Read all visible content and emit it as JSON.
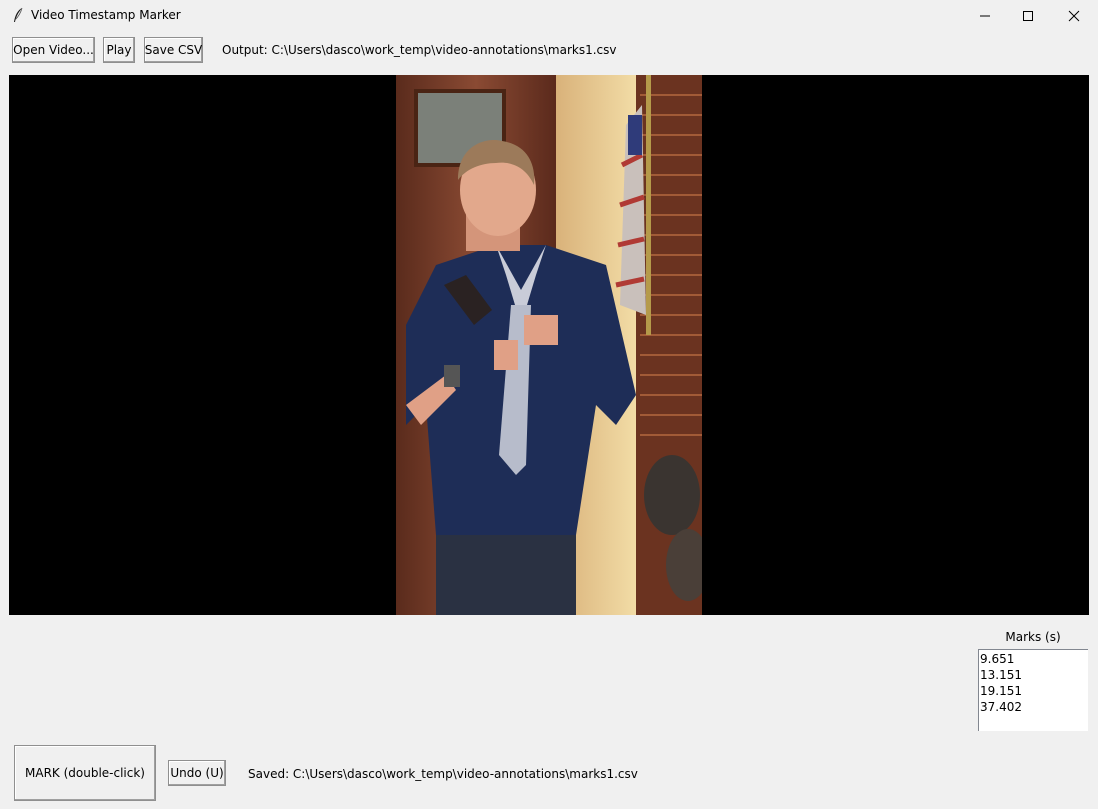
{
  "window": {
    "title": "Video Timestamp Marker",
    "icon": "feather-icon",
    "controls": [
      "minimize-icon",
      "maximize-icon",
      "close-icon"
    ]
  },
  "toolbar": {
    "open_label": "Open Video...",
    "play_label": "Play",
    "save_label": "Save CSV",
    "output_text": "Output: C:\\Users\\dasco\\work_temp\\video-annotations\\marks1.csv"
  },
  "marks": {
    "title": "Marks (s)",
    "items": [
      "9.651",
      "13.151",
      "19.151",
      "37.402"
    ]
  },
  "bottom": {
    "mark_label": "MARK (double-click)",
    "undo_label": "Undo (U)",
    "saved_text": "Saved: C:\\Users\\dasco\\work_temp\\video-annotations\\marks1.csv"
  },
  "colors": {
    "video_background": "#000000",
    "window_background": "#f0f0f0"
  }
}
